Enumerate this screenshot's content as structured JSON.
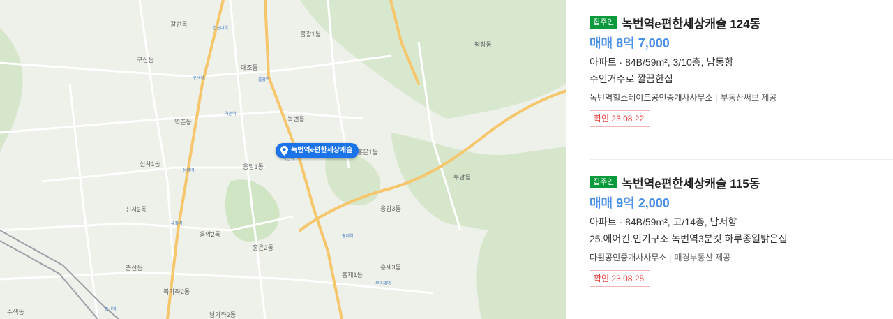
{
  "map": {
    "pin_label": "녹번역e편한세상캐슬",
    "pin_sub": "녹번역\ne편한세상캐슬",
    "areas": [
      "불광1동",
      "구산동",
      "대조동",
      "갈현동",
      "역촌동",
      "녹번동",
      "응암1동",
      "응암2동",
      "신사1동",
      "신사2동",
      "응암3동",
      "증산동",
      "홍은1동",
      "홍은2동",
      "홍제1동",
      "홍제3동",
      "부암동",
      "평창동",
      "북가좌2동",
      "남가좌2동",
      "수색동"
    ],
    "pois": [
      "연신내역",
      "녹번역",
      "구산역",
      "역촌역",
      "응암역",
      "새절역",
      "홍제역",
      "무악재역",
      "증산역",
      "불광역"
    ],
    "colors": {
      "road_major": "#f5c66b",
      "road_minor": "#ffffff",
      "green": "#cfe5c4",
      "rail": "#9aa0a6",
      "pin": "#1a73e8"
    }
  },
  "listings": [
    {
      "badge": "집주인",
      "title": "녹번역e편한세상캐슬 124동",
      "price": "매매 8억 7,000",
      "spec": "아파트 · 84B/59m², 3/10층, 남동향",
      "desc": "주인거주로 깔끔한집",
      "agency": "녹번역힐스테이트공인중개사사무소",
      "provider": "부동산써브 제공",
      "confirm": "확인 23.08.22."
    },
    {
      "badge": "집주인",
      "title": "녹번역e편한세상캐슬 115동",
      "price": "매매 9억 2,000",
      "spec": "아파트 · 84B/59m², 고/14층, 남서향",
      "desc": "25.에어컨.인기구조.녹번역3분컷.하루종일밝은집",
      "agency": "다원공인중개사사무소",
      "provider": "매경부동산 제공",
      "confirm": "확인 23.08.25."
    }
  ]
}
